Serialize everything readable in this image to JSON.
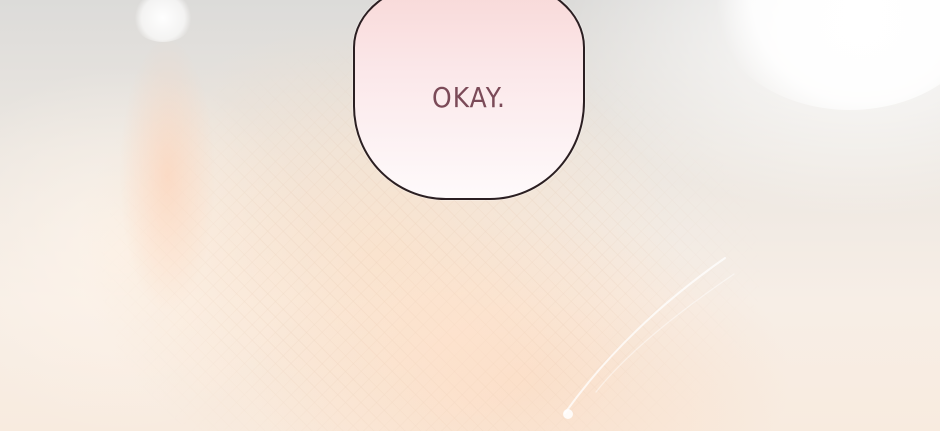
{
  "scene": {
    "speech_text": "OKAY."
  },
  "colors": {
    "bubble_border": "#2b1f22",
    "speech_text": "#7b4a58",
    "warm_highlight": "#ffcdaf",
    "background": "#f3efea"
  }
}
